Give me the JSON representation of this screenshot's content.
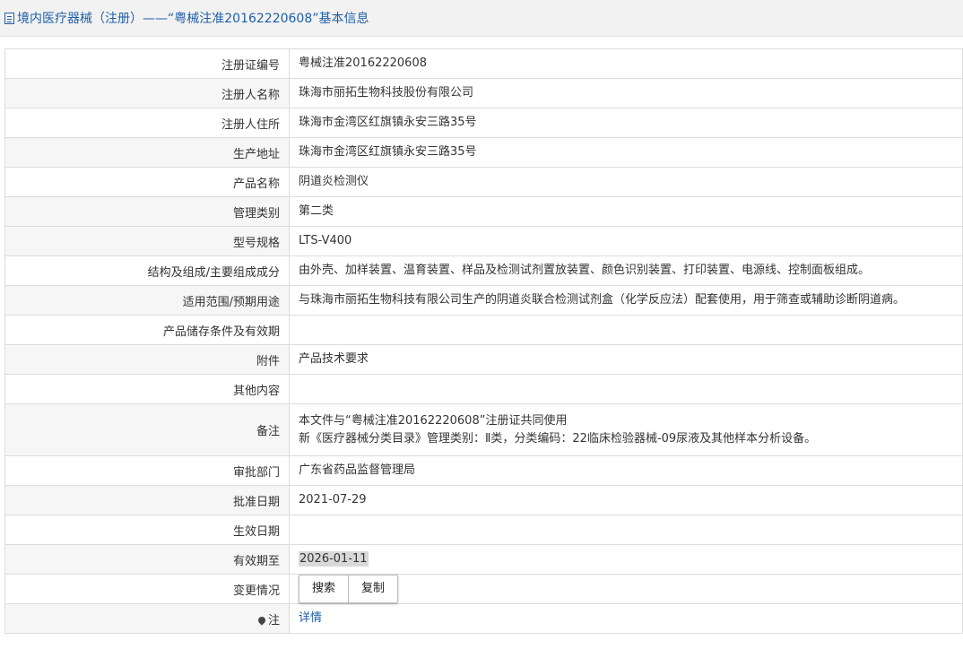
{
  "header": {
    "title": "境内医疗器械（注册）——“粤械注准20162220608”基本信息",
    "icon": "document-icon"
  },
  "rows": [
    {
      "label": "注册证编号",
      "value": "粤械注准20162220608"
    },
    {
      "label": "注册人名称",
      "value": "珠海市丽拓生物科技股份有限公司"
    },
    {
      "label": "注册人住所",
      "value": "珠海市金湾区红旗镇永安三路35号"
    },
    {
      "label": "生产地址",
      "value": "珠海市金湾区红旗镇永安三路35号"
    },
    {
      "label": "产品名称",
      "value": "阴道炎检测仪"
    },
    {
      "label": "管理类别",
      "value": "第二类"
    },
    {
      "label": "型号规格",
      "value": "LTS-V400"
    },
    {
      "label": "结构及组成/主要组成成分",
      "value": "由外壳、加样装置、温育装置、样品及检测试剂置放装置、颜色识别装置、打印装置、电源线、控制面板组成。"
    },
    {
      "label": "适用范围/预期用途",
      "value": "与珠海市丽拓生物科技有限公司生产的阴道炎联合检测试剂盒（化学反应法）配套使用，用于筛查或辅助诊断阴道病。"
    },
    {
      "label": "产品储存条件及有效期",
      "value": ""
    },
    {
      "label": "附件",
      "value": "产品技术要求"
    },
    {
      "label": "其他内容",
      "value": ""
    },
    {
      "label": "备注",
      "value_line1": "本文件与“粤械注准20162220608”注册证共同使用",
      "value_line2": "新《医疗器械分类目录》管理类别：Ⅱ类，分类编码：22临床检验器械-09尿液及其他样本分析设备。"
    },
    {
      "label": "审批部门",
      "value": "广东省药品监督管理局"
    },
    {
      "label": "批准日期",
      "value": "2021-07-29"
    },
    {
      "label": "生效日期",
      "value": ""
    },
    {
      "label": "有效期至",
      "value": "2026-01-11"
    },
    {
      "label": "变更情况",
      "buttons": [
        "搜索",
        "复制"
      ]
    },
    {
      "label": "注",
      "icon": "map-pin-icon",
      "link": "详情"
    }
  ]
}
